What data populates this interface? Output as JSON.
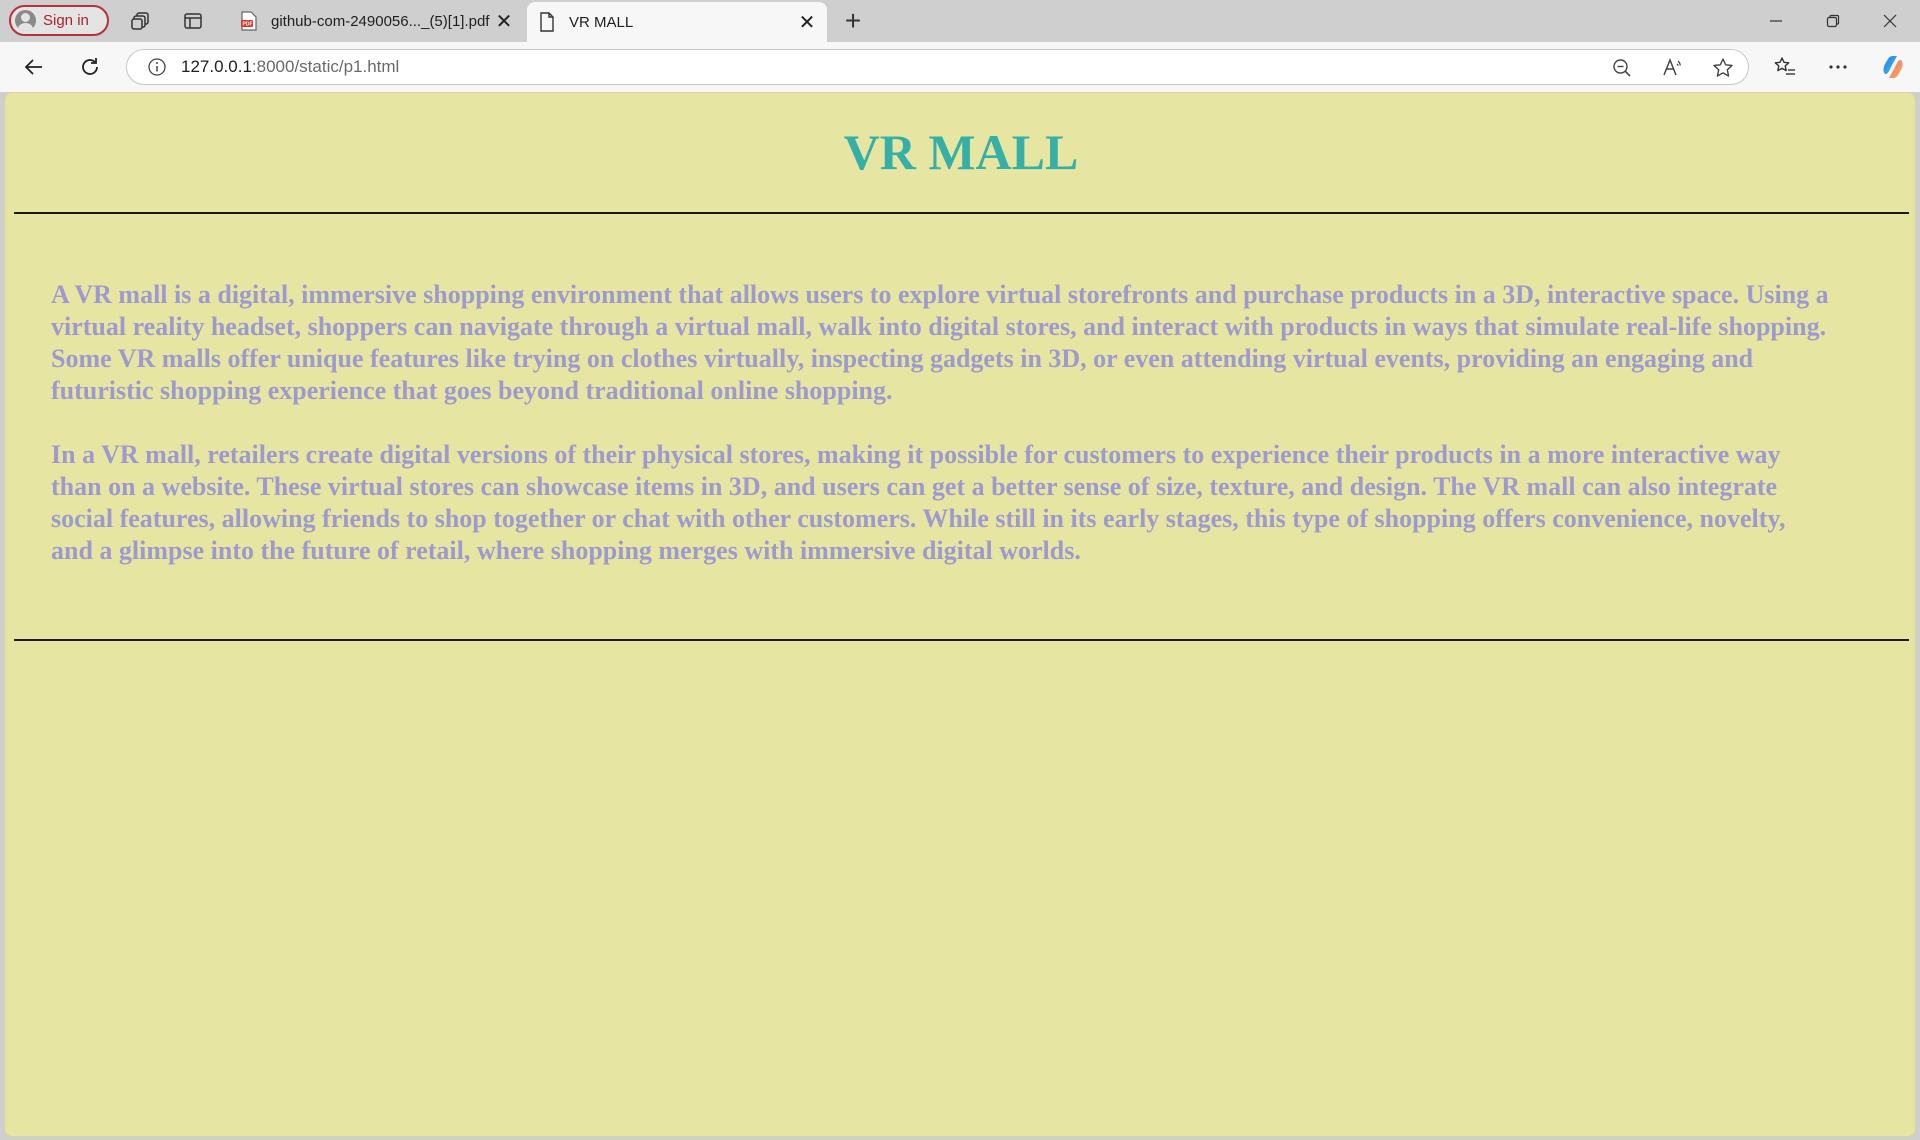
{
  "browser": {
    "signin_label": "Sign in",
    "tabs": [
      {
        "title": "github-com-2490056..._(5)[1].pdf",
        "icon": "pdf-icon",
        "active": false
      },
      {
        "title": "VR MALL",
        "icon": "page-icon",
        "active": true
      }
    ],
    "address": {
      "host": "127.0.0.1",
      "path": ":8000/static/p1.html"
    }
  },
  "page": {
    "title": "VR MALL",
    "paragraphs": [
      "A VR mall is a digital, immersive shopping environment that allows users to explore virtual storefronts and purchase products in a 3D, interactive space. Using a virtual reality headset, shoppers can navigate through a virtual mall, walk into digital stores, and interact with products in ways that simulate real-life shopping. Some VR malls offer unique features like trying on clothes virtually, inspecting gadgets in 3D, or even attending virtual events, providing an engaging and futuristic shopping experience that goes beyond traditional online shopping.",
      "In a VR mall, retailers create digital versions of their physical stores, making it possible for customers to experience their products in a more interactive way than on a website. These virtual stores can showcase items in 3D, and users can get a better sense of size, texture, and design. The VR mall can also integrate social features, allowing friends to shop together or chat with other customers. While still in its early stages, this type of shopping offers convenience, novelty, and a glimpse into the future of retail, where shopping merges with immersive digital worlds."
    ]
  },
  "colors": {
    "page_background": "#e6e6a2",
    "title": "#36b0a7",
    "body_text": "#9e9ad0",
    "signin_accent": "#b5323a"
  }
}
